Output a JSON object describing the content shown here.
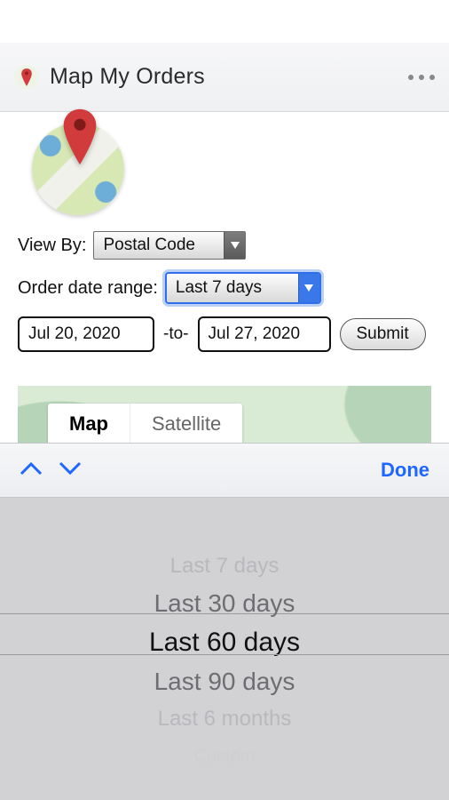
{
  "header": {
    "title": "Map My Orders"
  },
  "filters": {
    "viewByLabel": "View By:",
    "viewByValue": "Postal Code",
    "rangeLabel": "Order date range:",
    "rangeValue": "Last 7 days",
    "dateStart": "Jul 20, 2020",
    "dateTo": "-to-",
    "dateEnd": "Jul 27, 2020",
    "submitLabel": "Submit"
  },
  "map": {
    "tabMap": "Map",
    "tabSatellite": "Satellite",
    "activeTab": "Map"
  },
  "pickerToolbar": {
    "doneLabel": "Done"
  },
  "picker": {
    "options": [
      "Last 7 days",
      "Last 30 days",
      "Last 60 days",
      "Last 90 days",
      "Last 6 months",
      "Custom"
    ],
    "selectedIndex": 2
  }
}
